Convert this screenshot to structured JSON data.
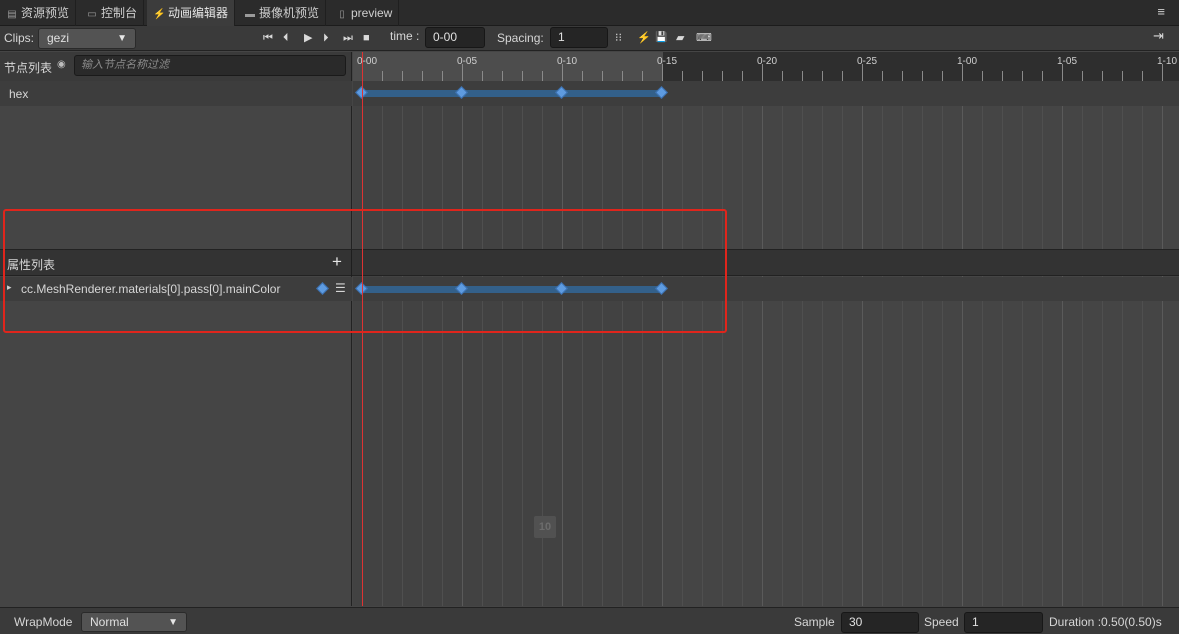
{
  "tabs": [
    {
      "icon": "file-icon",
      "glyph": "▤",
      "label": "资源预览",
      "active": false
    },
    {
      "icon": "console-icon",
      "glyph": "▭",
      "label": "控制台",
      "active": false
    },
    {
      "icon": "animation-icon",
      "glyph": "⚡",
      "label": "动画编辑器",
      "active": true
    },
    {
      "icon": "camera-icon",
      "glyph": "▬",
      "label": "摄像机预览",
      "active": false
    },
    {
      "icon": "document-icon",
      "glyph": "▯",
      "label": "preview",
      "active": false
    }
  ],
  "menu_glyph": "≡",
  "toolbar": {
    "clips_label": "Clips:",
    "clip_selected": "gezi",
    "time_label": "time :",
    "time_value": "0-00",
    "spacing_label": "Spacing:",
    "spacing_value": "1",
    "playback_glyphs": [
      "⏮",
      "⏴",
      "▶",
      "⏵",
      "⏭",
      "■"
    ],
    "tool_glyphs": [
      "⁝⁝",
      "⚡",
      "💾",
      "▰",
      "⌨"
    ],
    "exit_glyph": "⇥"
  },
  "node_panel": {
    "title": "节点列表",
    "eye_glyph": "◉",
    "filter_placeholder": "输入节点名称过滤",
    "node_name": "hex"
  },
  "ruler": {
    "labels": [
      "0-00",
      "0-05",
      "0-10",
      "0-15",
      "0-20",
      "0-25",
      "1-00",
      "1-05",
      "1-10"
    ]
  },
  "property_panel": {
    "title": "属性列表",
    "add_glyph": "+",
    "property_name": "cc.MeshRenderer.materials[0].pass[0].mainColor",
    "expand_glyph": "▸",
    "list_glyph": "☰"
  },
  "keyframes_frames": [
    0,
    5,
    10,
    15
  ],
  "page_badge": "10",
  "bottom": {
    "wrapmode_label": "WrapMode",
    "wrapmode_value": "Normal",
    "sample_label": "Sample",
    "sample_value": "30",
    "speed_label": "Speed",
    "speed_value": "1",
    "duration_text": "Duration :0.50(0.50)s"
  },
  "colors": {
    "accent_keyframe": "#5e9be0",
    "cursor": "#dd3333",
    "highlight_box": "#e0251c"
  }
}
